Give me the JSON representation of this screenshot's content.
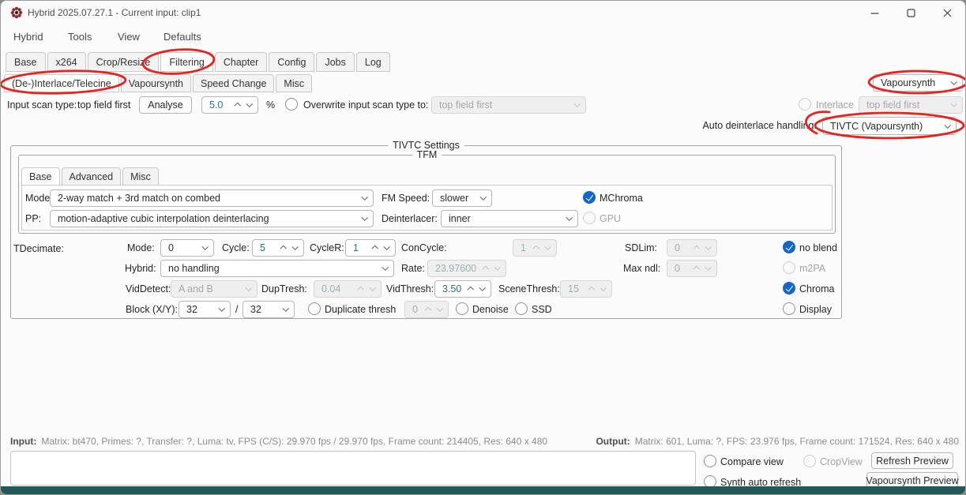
{
  "window": {
    "title": "Hybrid 2025.07.27.1 - Current input: clip1"
  },
  "menubar": {
    "items": [
      "Hybrid",
      "Tools",
      "View",
      "Defaults"
    ]
  },
  "main_tabs": {
    "items": [
      "Base",
      "x264",
      "Crop/Resize",
      "Filtering",
      "Chapter",
      "Config",
      "Jobs",
      "Log"
    ],
    "active": "Filtering"
  },
  "filter_tabs": {
    "items": [
      "(De-)Interlace/Telecine",
      "Vapoursynth",
      "Speed Change",
      "Misc"
    ],
    "active": "(De-)Interlace/Telecine"
  },
  "framework_dropdown": {
    "value": "Vapoursynth"
  },
  "scan_row": {
    "input_scan_label": "Input scan type:",
    "input_scan_value": "top field first",
    "analyse_button": "Analyse",
    "percent_value": "5.0",
    "percent_sign": "%",
    "overwrite_label": "Overwrite input scan type to:",
    "overwrite_value": "top field first",
    "interlace_label": "Interlace",
    "interlace_value": "top field first"
  },
  "auto_deinterlace": {
    "label": "Auto deinterlace handling:",
    "value": "TIVTC (Vapoursynth)"
  },
  "tivtc": {
    "group_title": "TIVTC Settings",
    "tfm": {
      "group_title": "TFM",
      "tabs": [
        "Base",
        "Advanced",
        "Misc"
      ],
      "mode_label": "Mode:",
      "mode_value": "2-way match + 3rd match on combed",
      "fm_speed_label": "FM Speed:",
      "fm_speed_value": "slower",
      "mchroma_label": "MChroma",
      "pp_label": "PP:",
      "pp_value": "motion-adaptive cubic interpolation deinterlacing",
      "deinterlacer_label": "Deinterlacer:",
      "deinterlacer_value": "inner",
      "gpu_label": "GPU"
    },
    "tdecimate": {
      "label": "TDecimate:",
      "mode_label": "Mode:",
      "mode_value": "0",
      "cycle_label": "Cycle:",
      "cycle_value": "5",
      "cycler_label": "CycleR:",
      "cycler_value": "1",
      "concycle_label": "ConCycle:",
      "concycle_value": "1",
      "sdlim_label": "SDLim:",
      "sdlim_value": "0",
      "noblend_label": "no blend",
      "hybrid_label": "Hybrid:",
      "hybrid_value": "no handling",
      "rate_label": "Rate:",
      "rate_value": "23.97600",
      "maxndl_label": "Max ndl:",
      "maxndl_value": "0",
      "m2pa_label": "m2PA",
      "viddetect_label": "VidDetect:",
      "viddetect_value": "A and B",
      "duptresh_label": "DupTresh:",
      "duptresh_value": "0.04",
      "vidthresh_label": "VidThresh:",
      "vidthresh_value": "3.50",
      "scenethresh_label": "SceneThresh:",
      "scenethresh_value": "15",
      "chroma_label": "Chroma",
      "block_label": "Block (X/Y):",
      "block_x": "32",
      "block_sep": "/",
      "block_y": "32",
      "dupthresh_label": "Duplicate thresh",
      "dupthresh_value": "0",
      "denoise_label": "Denoise",
      "ssd_label": "SSD",
      "display_label": "Display"
    }
  },
  "status": {
    "input_label": "Input:",
    "input_text": "Matrix: bt470, Primes: ?, Transfer: ?, Luma: tv, FPS (C/S): 29.970 fps / 29.970 fps, Frame count: 214405, Res: 640 x 480",
    "output_label": "Output:",
    "output_text": "Matrix: 601, Luma: ?, FPS: 23.976 fps, Frame count: 171524, Res: 640 x 480"
  },
  "preview": {
    "compare_view": "Compare view",
    "crop_view": "CropView",
    "refresh_button": "Refresh Preview",
    "synth_auto": "Synth auto refresh",
    "vapoursynth_button": "Vapoursynth Preview"
  },
  "colors": {
    "accent_checked": "#1467c8",
    "spin_value_text": "#2e7373",
    "annotation_red": "#e3241f",
    "bottom_bar": "#235858"
  }
}
